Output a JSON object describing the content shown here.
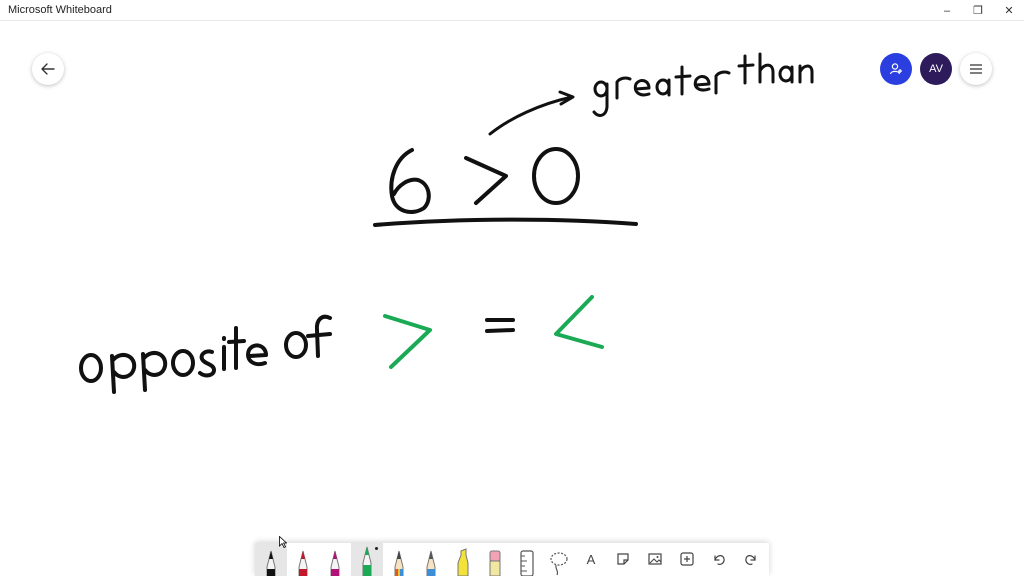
{
  "window": {
    "title": "Microsoft Whiteboard",
    "controls": {
      "minimize": "‒",
      "restore": "❐",
      "close": "✕"
    }
  },
  "header": {
    "back_icon": "arrow-left-icon",
    "share_icon": "person-add-icon",
    "avatar_initials": "AV",
    "menu_icon": "hamburger-menu-icon"
  },
  "board": {
    "ink_color_black": "#111111",
    "ink_color_green": "#1aaa55",
    "handwriting": {
      "expression": "6 > 0",
      "annotation": "greater than",
      "statement": "opposite of",
      "equals": "=",
      "symbol_greater": ">",
      "symbol_less": "<"
    }
  },
  "toolbar": {
    "tools": [
      {
        "name": "pen-black",
        "color": "#111111",
        "selected": true
      },
      {
        "name": "pen-red",
        "color": "#c2182b"
      },
      {
        "name": "pen-magenta",
        "color": "#b0127a"
      },
      {
        "name": "pen-green",
        "color": "#1aaa55",
        "active_dot": true
      },
      {
        "name": "pencil-rainbow",
        "color": "#e0592a"
      },
      {
        "name": "pencil-blue",
        "color": "#3a8fd6"
      },
      {
        "name": "highlighter-yellow",
        "color": "#f3e23a"
      },
      {
        "name": "eraser",
        "color": "#f2a3b5"
      },
      {
        "name": "ruler",
        "icon": "ruler-icon"
      },
      {
        "name": "lasso",
        "icon": "lasso-icon"
      },
      {
        "name": "text",
        "icon": "text-icon",
        "label": "A"
      },
      {
        "name": "sticky-note",
        "icon": "note-icon"
      },
      {
        "name": "image",
        "icon": "image-icon"
      },
      {
        "name": "insert",
        "icon": "plus-box-icon"
      },
      {
        "name": "undo",
        "icon": "undo-icon"
      },
      {
        "name": "redo",
        "icon": "redo-icon"
      }
    ]
  }
}
